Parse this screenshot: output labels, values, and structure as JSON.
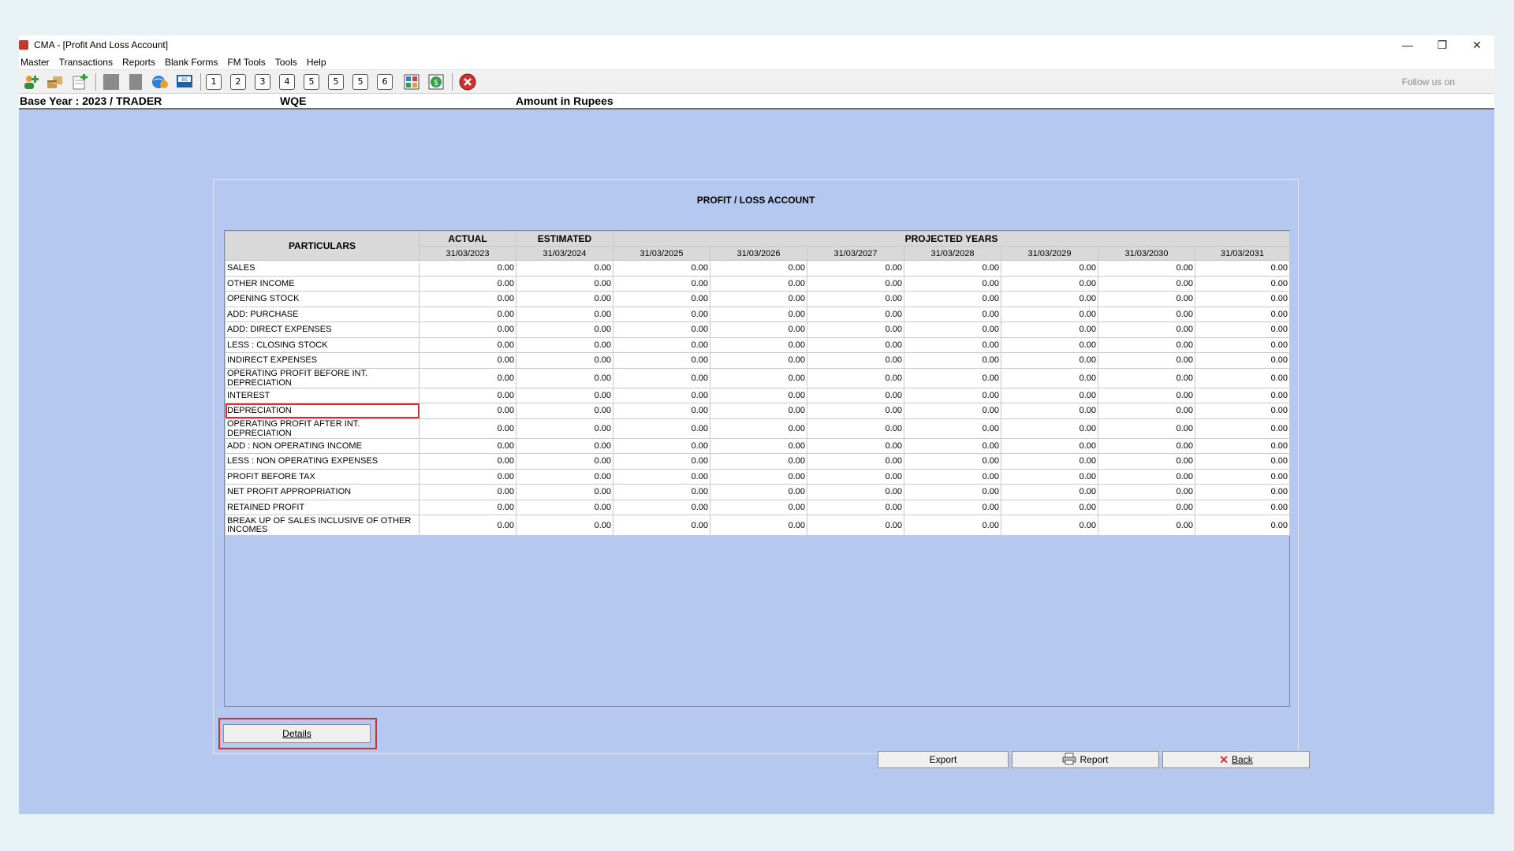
{
  "window": {
    "title": "CMA - [Profit And Loss Account]",
    "controls": [
      "—",
      "❐",
      "✕"
    ]
  },
  "menu": [
    "Master",
    "Transactions",
    "Reports",
    "Blank Forms",
    "FM Tools",
    "Tools",
    "Help"
  ],
  "toolbar": {
    "numbers": [
      "1",
      "2",
      "3",
      "4",
      "5",
      "5",
      "5",
      "6"
    ],
    "follow_text": "Follow us on"
  },
  "info": {
    "base_year": "Base Year : 2023 / TRADER",
    "company": "WQE",
    "amount": "Amount in Rupees"
  },
  "panel": {
    "title": "PROFIT / LOSS ACCOUNT"
  },
  "table": {
    "header": {
      "particulars": "PARTICULARS",
      "actual": "ACTUAL",
      "estimated": "ESTIMATED",
      "projected": "PROJECTED YEARS"
    },
    "dates": [
      "31/03/2023",
      "31/03/2024",
      "31/03/2025",
      "31/03/2026",
      "31/03/2027",
      "31/03/2028",
      "31/03/2029",
      "31/03/2030",
      "31/03/2031"
    ],
    "rows": [
      {
        "label": "SALES",
        "values": [
          "0.00",
          "0.00",
          "0.00",
          "0.00",
          "0.00",
          "0.00",
          "0.00",
          "0.00",
          "0.00"
        ]
      },
      {
        "label": "OTHER INCOME",
        "values": [
          "0.00",
          "0.00",
          "0.00",
          "0.00",
          "0.00",
          "0.00",
          "0.00",
          "0.00",
          "0.00"
        ]
      },
      {
        "label": "OPENING STOCK",
        "values": [
          "0.00",
          "0.00",
          "0.00",
          "0.00",
          "0.00",
          "0.00",
          "0.00",
          "0.00",
          "0.00"
        ]
      },
      {
        "label": "ADD: PURCHASE",
        "values": [
          "0.00",
          "0.00",
          "0.00",
          "0.00",
          "0.00",
          "0.00",
          "0.00",
          "0.00",
          "0.00"
        ]
      },
      {
        "label": "ADD: DIRECT EXPENSES",
        "values": [
          "0.00",
          "0.00",
          "0.00",
          "0.00",
          "0.00",
          "0.00",
          "0.00",
          "0.00",
          "0.00"
        ]
      },
      {
        "label": "LESS : CLOSING STOCK",
        "values": [
          "0.00",
          "0.00",
          "0.00",
          "0.00",
          "0.00",
          "0.00",
          "0.00",
          "0.00",
          "0.00"
        ]
      },
      {
        "label": "INDIRECT EXPENSES",
        "values": [
          "0.00",
          "0.00",
          "0.00",
          "0.00",
          "0.00",
          "0.00",
          "0.00",
          "0.00",
          "0.00"
        ]
      },
      {
        "label": "OPERATING PROFIT BEFORE INT. DEPRECIATION",
        "values": [
          "0.00",
          "0.00",
          "0.00",
          "0.00",
          "0.00",
          "0.00",
          "0.00",
          "0.00",
          "0.00"
        ]
      },
      {
        "label": "INTEREST",
        "values": [
          "0.00",
          "0.00",
          "0.00",
          "0.00",
          "0.00",
          "0.00",
          "0.00",
          "0.00",
          "0.00"
        ]
      },
      {
        "label": "DEPRECIATION",
        "values": [
          "0.00",
          "0.00",
          "0.00",
          "0.00",
          "0.00",
          "0.00",
          "0.00",
          "0.00",
          "0.00"
        ],
        "highlight": true
      },
      {
        "label": "OPERATING PROFIT AFTER INT. DEPRECIATION",
        "values": [
          "0.00",
          "0.00",
          "0.00",
          "0.00",
          "0.00",
          "0.00",
          "0.00",
          "0.00",
          "0.00"
        ]
      },
      {
        "label": "ADD : NON OPERATING INCOME",
        "values": [
          "0.00",
          "0.00",
          "0.00",
          "0.00",
          "0.00",
          "0.00",
          "0.00",
          "0.00",
          "0.00"
        ]
      },
      {
        "label": "LESS : NON OPERATING EXPENSES",
        "values": [
          "0.00",
          "0.00",
          "0.00",
          "0.00",
          "0.00",
          "0.00",
          "0.00",
          "0.00",
          "0.00"
        ]
      },
      {
        "label": "PROFIT BEFORE TAX",
        "values": [
          "0.00",
          "0.00",
          "0.00",
          "0.00",
          "0.00",
          "0.00",
          "0.00",
          "0.00",
          "0.00"
        ]
      },
      {
        "label": "NET PROFIT APPROPRIATION",
        "values": [
          "0.00",
          "0.00",
          "0.00",
          "0.00",
          "0.00",
          "0.00",
          "0.00",
          "0.00",
          "0.00"
        ]
      },
      {
        "label": "RETAINED PROFIT",
        "values": [
          "0.00",
          "0.00",
          "0.00",
          "0.00",
          "0.00",
          "0.00",
          "0.00",
          "0.00",
          "0.00"
        ]
      },
      {
        "label": "BREAK UP OF SALES INCLUSIVE OF OTHER INCOMES",
        "values": [
          "0.00",
          "0.00",
          "0.00",
          "0.00",
          "0.00",
          "0.00",
          "0.00",
          "0.00",
          "0.00"
        ],
        "tall": true
      }
    ]
  },
  "buttons": {
    "details": "Details",
    "export": "Export",
    "report": "Report",
    "back": "Back"
  },
  "colors": {
    "background": "#b5c8ef",
    "highlight": "#d32f2f"
  }
}
